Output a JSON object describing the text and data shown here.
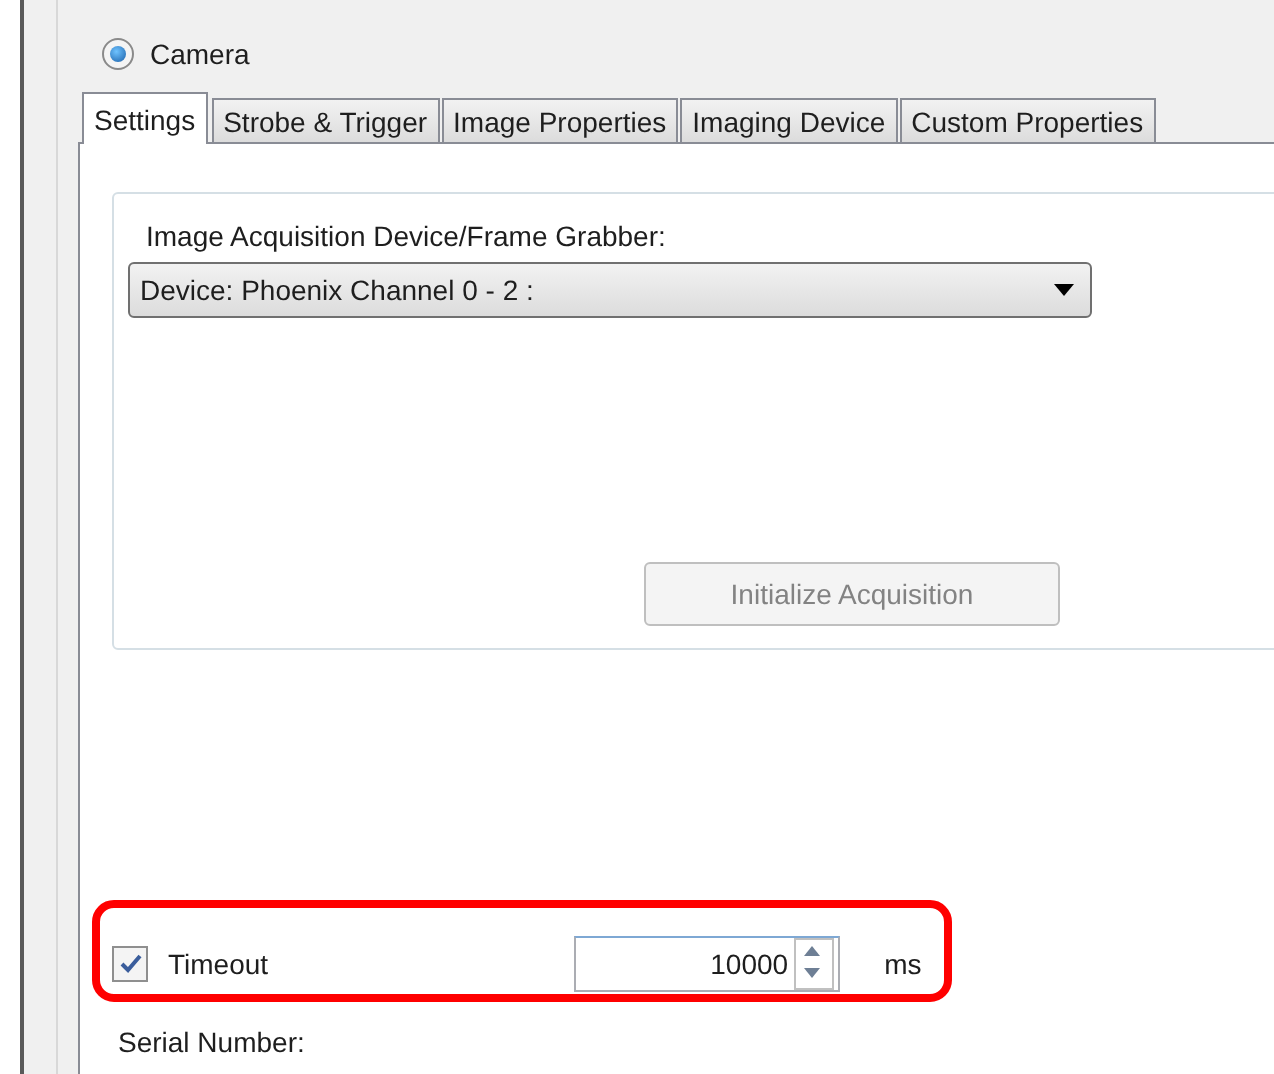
{
  "group": {
    "label": "Camera",
    "selected": true
  },
  "tabs": [
    {
      "label": "Settings",
      "selected": true
    },
    {
      "label": "Strobe & Trigger",
      "selected": false
    },
    {
      "label": "Image Properties",
      "selected": false
    },
    {
      "label": "Imaging Device",
      "selected": false
    },
    {
      "label": "Custom Properties",
      "selected": false
    }
  ],
  "device_group": {
    "label": "Image Acquisition Device/Frame Grabber:",
    "device_select": {
      "value": "Device: Phoenix Channel 0 - 2 :"
    },
    "button": {
      "label": "Initialize Acquisition",
      "disabled": true
    }
  },
  "timeout": {
    "label": "Timeout",
    "checked": true,
    "value": "10000",
    "unit": "ms"
  },
  "serial_number": {
    "label": "Serial Number:"
  }
}
